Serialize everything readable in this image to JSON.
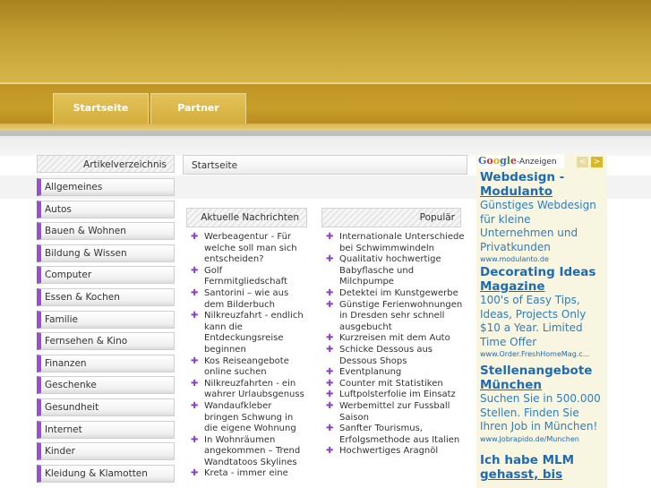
{
  "nav": {
    "tabs": [
      {
        "label": "Startseite"
      },
      {
        "label": "Partner"
      }
    ]
  },
  "sidebar": {
    "title": "Artikelverzeichnis",
    "items": [
      {
        "label": "Allgemeines"
      },
      {
        "label": "Autos"
      },
      {
        "label": "Bauen & Wohnen"
      },
      {
        "label": "Bildung & Wissen"
      },
      {
        "label": "Computer"
      },
      {
        "label": "Essen & Kochen"
      },
      {
        "label": "Familie"
      },
      {
        "label": "Fernsehen & Kino"
      },
      {
        "label": "Finanzen"
      },
      {
        "label": "Geschenke"
      },
      {
        "label": "Gesundheit"
      },
      {
        "label": "Internet"
      },
      {
        "label": "Kinder"
      },
      {
        "label": "Kleidung & Klamotten"
      }
    ]
  },
  "breadcrumb": {
    "label": "Startseite"
  },
  "news": {
    "title": "Aktuelle Nachrichten",
    "items": [
      "Werbeagentur - Für welche soll man sich entscheiden?",
      "Golf Fernmitgliedschaft",
      "Santorini – wie aus dem Bilderbuch",
      "Nilkreuzfahrt - endlich kann die Entdeckungsreise beginnen",
      "Kos Reiseangebote online suchen",
      "Nilkreuzfahrten - ein wahrer Urlaubsgenuss",
      "Wandaufkleber bringen Schwung in die eigene Wohnung",
      "In Wohnräumen angekommen – Trend Wandtatoos Skylines",
      "Kreta - immer eine"
    ]
  },
  "popular": {
    "title": "Populär",
    "items": [
      "Internationale Unterschiede bei Schwimmwindeln",
      "Qualitativ hochwertige Babyflasche und Milchpumpe",
      "Detektei im Kunstgewerbe",
      "Günstige Ferienwohnungen in Dresden sehr schnell ausgebucht",
      "Kurzreisen mit dem Auto",
      "Schicke Dessous aus Dessous Shops",
      "Eventplanung",
      "Counter mit Statistiken",
      "Luftpolsterfolie im Einsatz",
      "Werbemittel zur Fussball Saison",
      "Sanfter Tourismus, Erfolgsmethode aus Italien",
      "Hochwertiges Aragnöl"
    ]
  },
  "ads": {
    "header_google": "Google",
    "header_label": "-Anzeigen",
    "prev_glyph": "<",
    "next_glyph": ">",
    "items": [
      {
        "title_line1": "Webdesign -",
        "title_line2": "Modulanto",
        "desc": "Günstiges Webdesign für kleine Unternehmen und Privatkunden",
        "url": "www.modulanto.de"
      },
      {
        "title_line1": "Decorating Ideas",
        "title_line2": "Magazine",
        "desc": "100's of Easy Tips, Ideas, Projects Only $10 a Year. Limited Time Offer",
        "url": "www.Order.FreshHomeMag.c..."
      },
      {
        "title_line1": "Stellenangebote",
        "title_line2": "München",
        "desc": "Suchen Sie in 500.000 Stellen. Finden Sie Ihren Job in München!",
        "url": "www.Jobrapido.de/Munchen"
      },
      {
        "title_line1": "Ich habe MLM",
        "title_line2": "gehasst, bis",
        "desc": "",
        "url": ""
      }
    ]
  },
  "colors": {
    "header_gold": "#c4a033",
    "tab_gold": "#dcb84a",
    "bullet_purple": "#8b3fc8",
    "ad_link_blue": "#1e6bb5"
  }
}
